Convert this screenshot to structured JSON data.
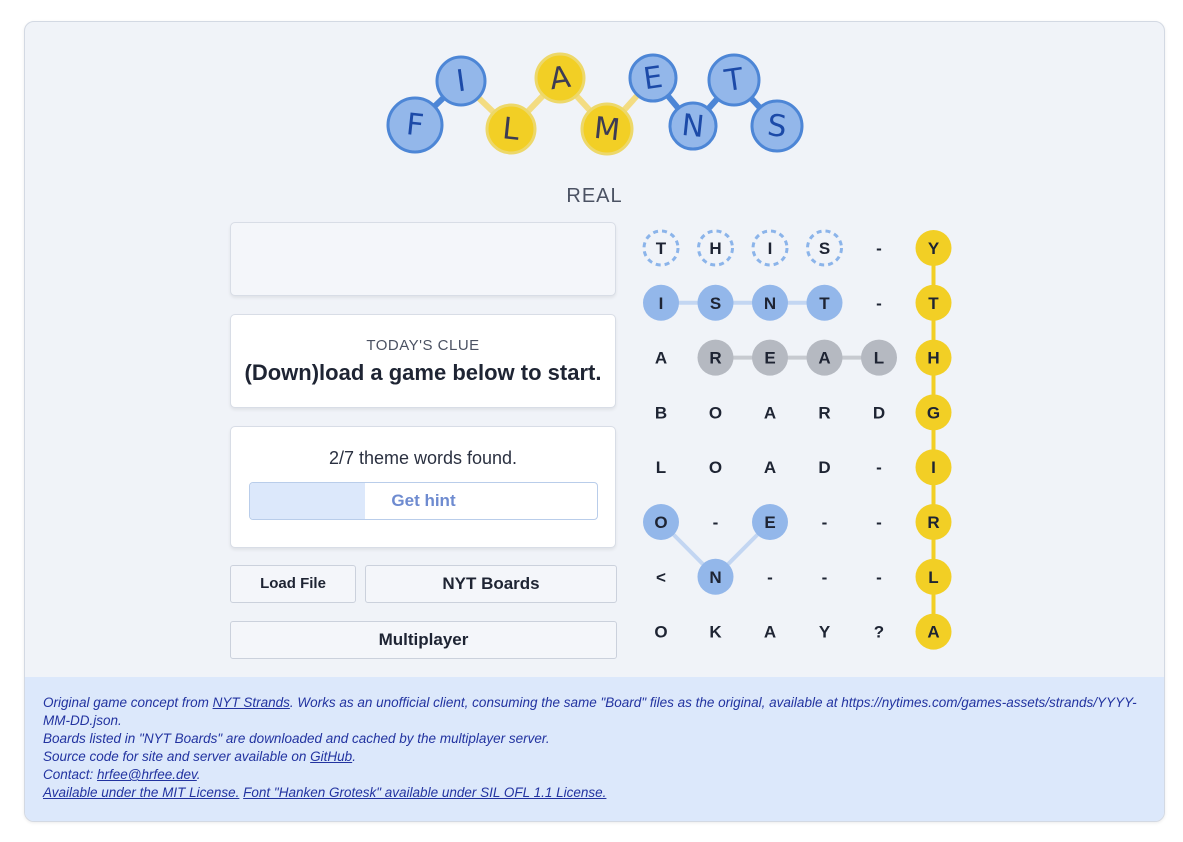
{
  "logo": {
    "letters": [
      {
        "char": "F",
        "color": "blue"
      },
      {
        "char": "I",
        "color": "blue"
      },
      {
        "char": "L",
        "color": "yellow"
      },
      {
        "char": "A",
        "color": "yellow"
      },
      {
        "char": "M",
        "color": "yellow"
      },
      {
        "char": "E",
        "color": "blue"
      },
      {
        "char": "N",
        "color": "blue"
      },
      {
        "char": "T",
        "color": "blue"
      },
      {
        "char": "S",
        "color": "blue"
      }
    ]
  },
  "page": {
    "title": "REAL"
  },
  "word_box": {
    "text": ""
  },
  "clue": {
    "label": "TODAY'S CLUE",
    "text": "(Down)load a game below to start."
  },
  "progress": {
    "text": "2/7 theme words found.",
    "hint_label": "Get hint",
    "hint_fraction": 0.33
  },
  "buttons": {
    "load_file": "Load File",
    "nyt_boards": "NYT Boards",
    "multiplayer": "Multiplayer"
  },
  "board": {
    "rows": [
      [
        "T",
        "H",
        "I",
        "S",
        "-",
        "Y"
      ],
      [
        "I",
        "S",
        "N",
        "T",
        "-",
        "T"
      ],
      [
        "A",
        "R",
        "E",
        "A",
        "L",
        "H"
      ],
      [
        "B",
        "O",
        "A",
        "R",
        "D",
        "G"
      ],
      [
        "L",
        "O",
        "A",
        "D",
        "-",
        "I"
      ],
      [
        "O",
        "-",
        "E",
        "-",
        "-",
        "R"
      ],
      [
        "<",
        "N",
        "-",
        "-",
        "-",
        "L"
      ],
      [
        "O",
        "K",
        "A",
        "Y",
        "?",
        "A"
      ]
    ],
    "states": [
      [
        "hint",
        "hint",
        "hint",
        "hint",
        "none",
        "spangram"
      ],
      [
        "found",
        "found",
        "found",
        "found",
        "none",
        "spangram"
      ],
      [
        "none",
        "selected",
        "selected",
        "selected",
        "selected",
        "spangram"
      ],
      [
        "none",
        "none",
        "none",
        "none",
        "none",
        "spangram"
      ],
      [
        "none",
        "none",
        "none",
        "none",
        "none",
        "spangram"
      ],
      [
        "found",
        "none",
        "found",
        "none",
        "none",
        "spangram"
      ],
      [
        "none",
        "found",
        "none",
        "none",
        "none",
        "spangram"
      ],
      [
        "none",
        "none",
        "none",
        "none",
        "none",
        "spangram"
      ]
    ],
    "paths": [
      {
        "state": "found",
        "cells": [
          [
            1,
            0
          ],
          [
            1,
            1
          ],
          [
            1,
            2
          ],
          [
            1,
            3
          ]
        ]
      },
      {
        "state": "selected",
        "cells": [
          [
            2,
            1
          ],
          [
            2,
            2
          ],
          [
            2,
            3
          ],
          [
            2,
            4
          ]
        ]
      },
      {
        "state": "found",
        "cells": [
          [
            5,
            0
          ],
          [
            6,
            1
          ],
          [
            5,
            2
          ]
        ]
      },
      {
        "state": "spangram",
        "cells": [
          [
            0,
            5
          ],
          [
            1,
            5
          ],
          [
            2,
            5
          ],
          [
            3,
            5
          ],
          [
            4,
            5
          ],
          [
            5,
            5
          ],
          [
            6,
            5
          ],
          [
            7,
            5
          ]
        ]
      }
    ],
    "colors": {
      "found": "#93b7ea",
      "found_line": "#c3d6f2",
      "selected": "#b5b9c1",
      "selected_line": "#c7cad0",
      "spangram": "#f2cf25",
      "hint_ring": "#8bb4ea",
      "text": "#1e2433"
    }
  },
  "footer": {
    "line1_prefix": "Original game concept from ",
    "line1_link": "NYT Strands",
    "line1_suffix": ". Works as an unofficial client, consuming the same \"Board\" files as the original, available at https://nytimes.com/games-assets/strands/YYYY-MM-DD.json.",
    "line2": "Boards listed in \"NYT Boards\" are downloaded and cached by the multiplayer server.",
    "line3_prefix": "Source code for site and server available on ",
    "line3_link": "GitHub",
    "line3_suffix": ".",
    "line4_prefix": "Contact: ",
    "line4_link": "hrfee@hrfee.dev",
    "line4_suffix": ".",
    "license_link": "Available under the MIT License.",
    "font_link": "Font \"Hanken Grotesk\" available under SIL OFL 1.1 License."
  }
}
